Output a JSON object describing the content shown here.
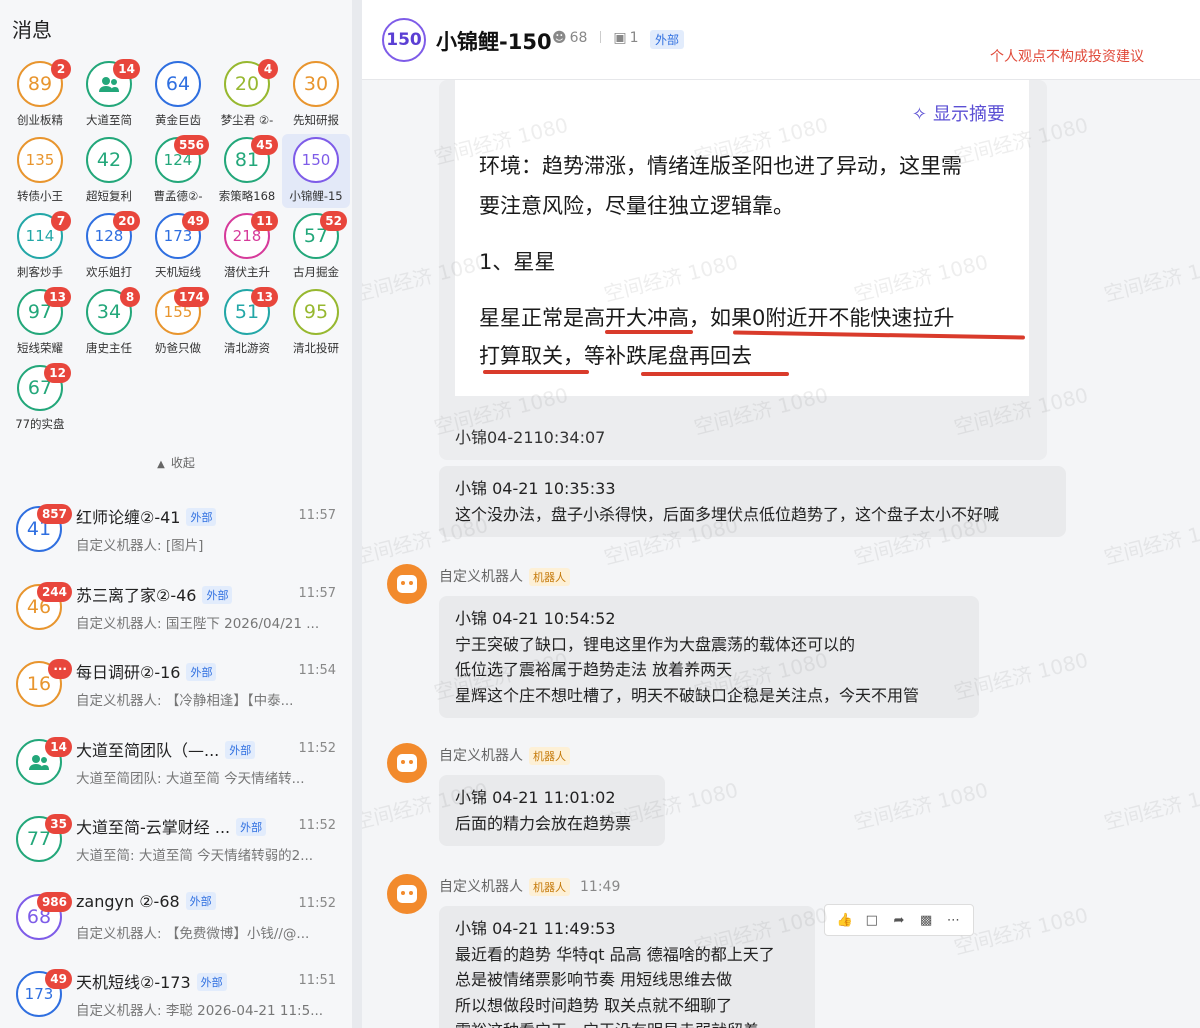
{
  "sidebar": {
    "title": "消息",
    "collapse_label": "收起",
    "grid": [
      {
        "label": "创业板精",
        "num": "89",
        "badge": "2",
        "color": "#e8952e"
      },
      {
        "label": "大道至简",
        "num": "",
        "badge": "14",
        "color": "#23a77a",
        "icon": "group-icon"
      },
      {
        "label": "黄金巨齿",
        "num": "64",
        "badge": "",
        "color": "#2f6fe0"
      },
      {
        "label": "梦尘君 ②-",
        "num": "20",
        "badge": "4",
        "color": "#97b830"
      },
      {
        "label": "先知研报",
        "num": "30",
        "badge": "",
        "color": "#e8952e"
      },
      {
        "label": "转债小王",
        "num": "135",
        "badge": "",
        "color": "#e8952e"
      },
      {
        "label": "超短复利",
        "num": "42",
        "badge": "",
        "color": "#23a77a"
      },
      {
        "label": "曹孟德②-",
        "num": "124",
        "badge": "556",
        "color": "#23a77a"
      },
      {
        "label": "索策略168",
        "num": "81",
        "badge": "45",
        "color": "#23a77a"
      },
      {
        "label": "小锦鲤-15",
        "num": "150",
        "badge": "",
        "color": "#7e5ce8"
      },
      {
        "label": "刺客炒手",
        "num": "114",
        "badge": "7",
        "color": "#23a7a7"
      },
      {
        "label": "欢乐姐打",
        "num": "128",
        "badge": "20",
        "color": "#2f6fe0"
      },
      {
        "label": "天机短线",
        "num": "173",
        "badge": "49",
        "color": "#2f6fe0"
      },
      {
        "label": "潜伏主升",
        "num": "218",
        "badge": "11",
        "color": "#d63a9a"
      },
      {
        "label": "古月掘金",
        "num": "57",
        "badge": "52",
        "color": "#23a77a"
      },
      {
        "label": "短线荣耀",
        "num": "97",
        "badge": "13",
        "color": "#23a77a"
      },
      {
        "label": "唐史主任",
        "num": "34",
        "badge": "8",
        "color": "#23a77a"
      },
      {
        "label": "奶爸只做",
        "num": "155",
        "badge": "174",
        "color": "#e8952e"
      },
      {
        "label": "清北游资",
        "num": "51",
        "badge": "13",
        "color": "#23a7a7"
      },
      {
        "label": "清北投研",
        "num": "95",
        "badge": "",
        "color": "#97b830"
      },
      {
        "label": "77的实盘",
        "num": "67",
        "badge": "12",
        "color": "#23a77a"
      }
    ],
    "conversations": [
      {
        "num": "41",
        "badge": "857",
        "color": "#2f6fe0",
        "name": "红师论缠②-41",
        "tag": "外部",
        "time": "11:57",
        "preview": "自定义机器人: [图片]"
      },
      {
        "num": "46",
        "badge": "244",
        "color": "#e8952e",
        "name": "苏三离了家②-46",
        "tag": "外部",
        "time": "11:57",
        "preview": "自定义机器人: 国王陛下 2026/04/21 ..."
      },
      {
        "num": "16",
        "badge": "···",
        "color": "#e8952e",
        "name": "每日调研②-16",
        "tag": "外部",
        "time": "11:54",
        "preview": "自定义机器人: 【冷静相逢】【中泰..."
      },
      {
        "num": "",
        "badge": "14",
        "color": "#23a77a",
        "name": "大道至简团队（—...",
        "tag": "外部",
        "time": "11:52",
        "preview": "大道至简团队: 大道至简 今天情绪转...",
        "icon": "group-icon"
      },
      {
        "num": "77",
        "badge": "35",
        "color": "#23a77a",
        "name": "大道至简-云掌财经 ...",
        "tag": "外部",
        "time": "11:52",
        "preview": "大道至简: 大道至简 今天情绪转弱的2..."
      },
      {
        "num": "68",
        "badge": "986",
        "color": "#7e5ce8",
        "name": "zangyn ②-68",
        "tag": "外部",
        "time": "11:52",
        "preview": "自定义机器人: 【免费微博】小钱//@..."
      },
      {
        "num": "173",
        "badge": "49",
        "color": "#2f6fe0",
        "name": "天机短线②-173",
        "tag": "外部",
        "time": "11:51",
        "preview": "自定义机器人: 李聪 2026-04-21 11:5..."
      }
    ]
  },
  "chat": {
    "avatar_num": "150",
    "title": "小锦鲤-150",
    "member_count": "68",
    "bot_count": "1",
    "tag": "外部",
    "disclaimer": "个人观点不构成投资建议",
    "watermark": "空间经济 1080",
    "image_card": {
      "summary_label": "显示摘要",
      "line1": "环境：趋势滞涨，情绪连版圣阳也进了异动，这里需",
      "line2": "要注意风险，尽量往独立逻辑靠。",
      "line3": "1、星星",
      "line4": "星星正常是高开大冲高，如果0附近开不能快速拉升",
      "line5": "打算取关，等补跌尾盘再回去",
      "caption": "小锦04-2110:34:07"
    },
    "messages": [
      {
        "lines": [
          "小锦  04-21 10:35:33",
          "这个没办法，盘子小杀得快，后面多埋伏点低位趋势了，这个盘子太小不好喊"
        ]
      },
      {
        "sender": "自定义机器人",
        "sender_tag": "机器人",
        "sender_time": "",
        "lines": [
          "小锦  04-21 10:54:52",
          "宁王突破了缺口，锂电这里作为大盘震荡的载体还可以的",
          "低位选了震裕属于趋势走法 放着养两天",
          "星辉这个庄不想吐槽了，明天不破缺口企稳是关注点，今天不用管"
        ]
      },
      {
        "sender": "自定义机器人",
        "sender_tag": "机器人",
        "sender_time": "",
        "lines": [
          "小锦  04-21 11:01:02",
          "后面的精力会放在趋势票"
        ]
      },
      {
        "sender": "自定义机器人",
        "sender_tag": "机器人",
        "sender_time": "11:49",
        "lines": [
          "小锦  04-21 11:49:53",
          "最近看的趋势 华特qt 品高 德福啥的都上天了",
          "总是被情绪票影响节奏 用短线思维去做",
          "所以想做段时间趋势 取关点就不细聊了",
          "震裕这种看宁王，宁王没有明显走弱就留着"
        ]
      }
    ]
  }
}
